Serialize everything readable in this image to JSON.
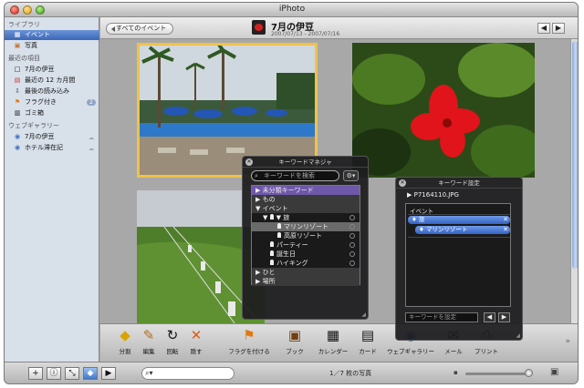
{
  "window": {
    "title": "iPhoto"
  },
  "sidebar": {
    "library_header": "ライブラリ",
    "library": [
      {
        "label": "イベント",
        "icon": "events-icon",
        "selected": true
      },
      {
        "label": "写真",
        "icon": "photos-icon"
      }
    ],
    "recent_header": "最近の項目",
    "recent": [
      {
        "label": "7月の伊豆",
        "icon": "event-icon"
      },
      {
        "label": "最近の 12 カ月間",
        "icon": "calendar-icon"
      },
      {
        "label": "最後の読み込み",
        "icon": "import-icon"
      },
      {
        "label": "フラグ付き",
        "icon": "flag-icon",
        "badge": "2"
      },
      {
        "label": "ゴミ箱",
        "icon": "trash-icon"
      }
    ],
    "web_header": "ウェブギャラリー",
    "web": [
      {
        "label": "7月の伊豆",
        "icon": "gallery-icon"
      },
      {
        "label": "ホテル滞在記",
        "icon": "gallery-icon"
      }
    ]
  },
  "header": {
    "back_label": "すべてのイベント",
    "event_title": "7月の伊豆",
    "event_dates": "2007/07/13 - 2007/07/16"
  },
  "toolbar": {
    "items": [
      {
        "label": "分割",
        "icon": "split-icon"
      },
      {
        "label": "編集",
        "icon": "edit-icon"
      },
      {
        "label": "回転",
        "icon": "rotate-icon"
      },
      {
        "label": "隠す",
        "icon": "hide-icon"
      },
      {
        "label": "フラグを付ける",
        "icon": "flag-icon"
      },
      {
        "label": "ブック",
        "icon": "book-icon"
      },
      {
        "label": "カレンダー",
        "icon": "calendar-icon"
      },
      {
        "label": "カード",
        "icon": "card-icon"
      },
      {
        "label": "ウェブギャラリー",
        "icon": "web-gallery-icon"
      },
      {
        "label": "メール",
        "icon": "mail-icon"
      },
      {
        "label": "プリント",
        "icon": "print-icon"
      }
    ],
    "more": "»"
  },
  "status": {
    "search_placeholder": "",
    "photo_count": "1／7 枚の写真"
  },
  "keyword_manager": {
    "title": "キーワードマネジャ",
    "search_placeholder": "キーワードを検索",
    "rows": [
      {
        "label": "▶ 未分類キーワード",
        "style": "purple"
      },
      {
        "label": "▶ もの",
        "style": "cat"
      },
      {
        "label": "▼ イベント",
        "style": "cat"
      },
      {
        "label": "▼ 旅",
        "indent": 2,
        "pin": true
      },
      {
        "label": "マリンリゾート",
        "indent": 3,
        "pin": true,
        "selected": true
      },
      {
        "label": "高原リゾート",
        "indent": 3,
        "pin": true
      },
      {
        "label": "パーティー",
        "indent": 2,
        "pin": true
      },
      {
        "label": "誕生日",
        "indent": 2,
        "pin": true
      },
      {
        "label": "ハイキング",
        "indent": 2,
        "pin": true
      },
      {
        "label": "▶ ひと",
        "style": "cat"
      },
      {
        "label": "▶ 場所",
        "style": "cat"
      }
    ]
  },
  "keyword_assign": {
    "title": "キーワード設定",
    "file_name": "P7164110.JPG",
    "group_label": "イベント",
    "tokens": [
      "旅",
      "マリンリゾート"
    ],
    "input_placeholder": "キーワードを設定"
  }
}
